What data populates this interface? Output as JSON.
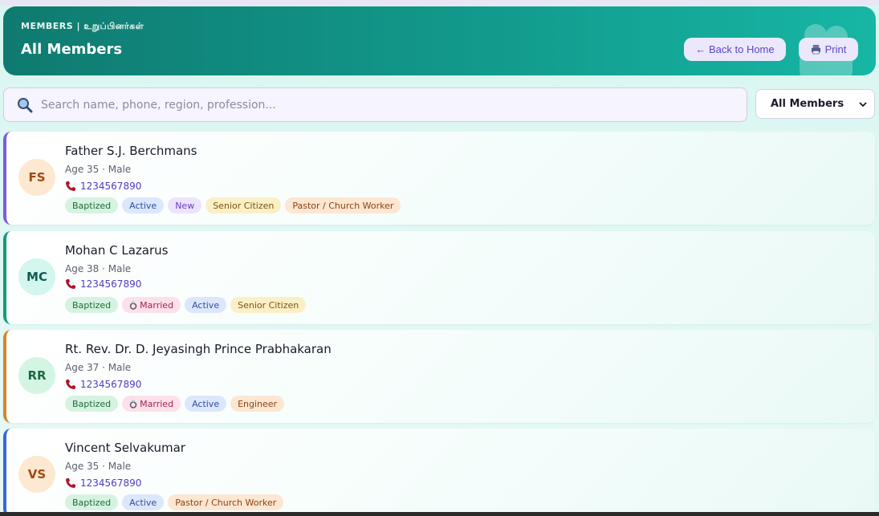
{
  "header": {
    "kicker": "MEMBERS | உறுப்பினர்கள்",
    "title": "All Members",
    "back_label": "← Back to Home",
    "print_label": "Print"
  },
  "search": {
    "placeholder": "Search name, phone, region, profession..."
  },
  "filter": {
    "selected": "All Members"
  },
  "members": [
    {
      "initials": "FS",
      "name": "Father S.J. Berchmans",
      "meta": "Age 35 · Male",
      "phone": "1234567890",
      "tags": [
        "Baptized",
        "Active",
        "New",
        "Senior Citizen",
        "Pastor / Church Worker"
      ]
    },
    {
      "initials": "MC",
      "name": "Mohan C Lazarus",
      "meta": "Age 38 · Male",
      "phone": "1234567890",
      "tags": [
        "Baptized",
        "Married",
        "Active",
        "Senior Citizen"
      ]
    },
    {
      "initials": "RR",
      "name": "Rt. Rev. Dr. D. Jeyasingh Prince Prabhakaran",
      "meta": "Age 37 · Male",
      "phone": "1234567890",
      "tags": [
        "Baptized",
        "Married",
        "Active",
        "Engineer"
      ]
    },
    {
      "initials": "VS",
      "name": "Vincent Selvakumar",
      "meta": "Age 35 · Male",
      "phone": "1234567890",
      "tags": [
        "Baptized",
        "Active",
        "Pastor / Church Worker"
      ]
    }
  ],
  "colors": {
    "header_start": "#0f7a70",
    "header_end": "#17b6a5",
    "accent": "#5b45c8",
    "card1_border": "#7c5be0",
    "card2_border": "#139a7c",
    "card3_border": "#d4862a",
    "card4_border": "#3a66d8"
  },
  "icons": [
    "search-icon",
    "print-icon",
    "phone-icon",
    "ring-icon",
    "members-watermark-icon",
    "chevron-down-icon"
  ]
}
